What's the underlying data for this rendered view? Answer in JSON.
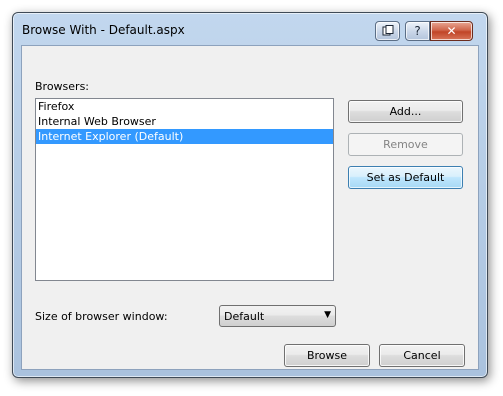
{
  "window": {
    "title": "Browse With - Default.aspx",
    "caption_buttons": {
      "copy_icon": "copy-icon",
      "help_label": "?",
      "close_label": "✕"
    }
  },
  "browsers_label": "Browsers:",
  "browsers": [
    {
      "label": "Firefox",
      "selected": false
    },
    {
      "label": "Internal Web Browser",
      "selected": false
    },
    {
      "label": "Internet Explorer (Default)",
      "selected": true
    }
  ],
  "buttons": {
    "add": "Add...",
    "remove": "Remove",
    "set_default": "Set as Default",
    "browse": "Browse",
    "cancel": "Cancel"
  },
  "window_size": {
    "label": "Size of browser window:",
    "selected": "Default"
  },
  "colors": {
    "selection": "#3399ff",
    "close_button": "#c14427"
  }
}
